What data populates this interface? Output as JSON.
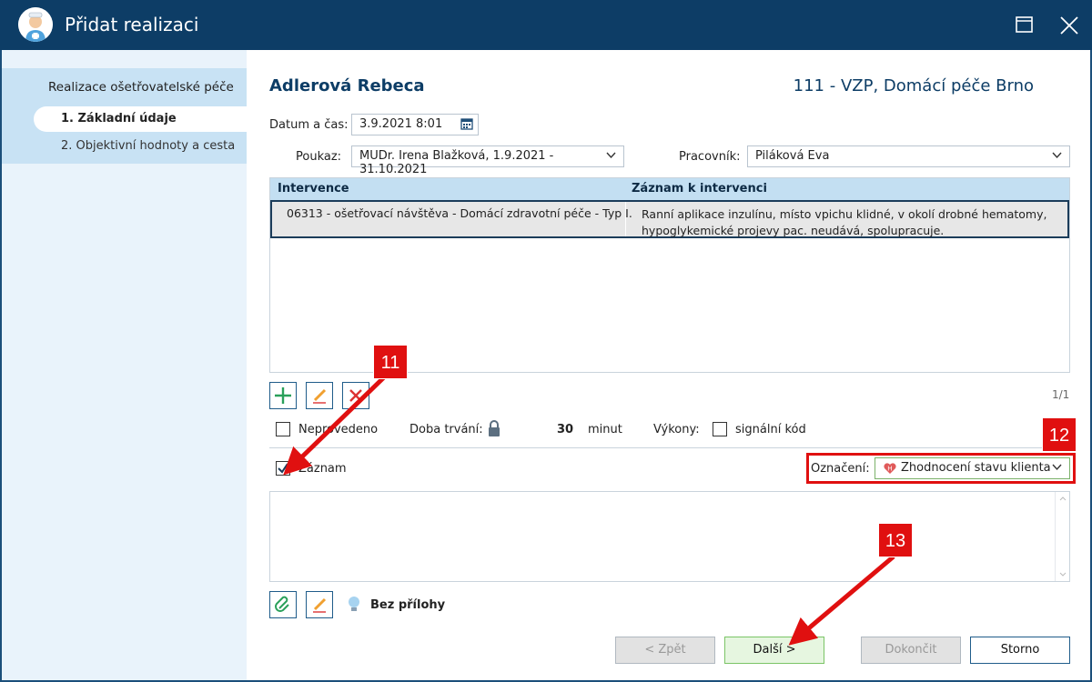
{
  "window": {
    "title": "Přidat realizaci"
  },
  "sidebar": {
    "heading": "Realizace ošetřovatelské péče",
    "items": [
      {
        "label": "1. Základní údaje",
        "active": true
      },
      {
        "label": "2. Objektivní hodnoty a cesta",
        "active": false
      }
    ]
  },
  "header": {
    "patient_name": "Adlerová Rebeca",
    "insurer": "111 - VZP, Domácí péče Brno"
  },
  "form": {
    "datetime_label": "Datum a čas:",
    "datetime_value": "3.9.2021 8:01",
    "voucher_label": "Poukaz:",
    "voucher_value": "MUDr. Irena Blažková, 1.9.2021 - 31.10.2021",
    "worker_label": "Pracovník:",
    "worker_value": "Piláková Eva"
  },
  "grid": {
    "columns": [
      "Intervence",
      "Záznam k intervenci"
    ],
    "rows": [
      {
        "intervention": "06313 - ošetřovací návštěva - Domácí zdravotní péče - Typ I.",
        "record_line1": "Ranní aplikace inzulínu, místo vpichu klidné, v okolí drobné hematomy,",
        "record_line2": "hypoglykemické projevy pac. neudává, spolupracuje."
      }
    ],
    "pager": "1/1"
  },
  "options": {
    "not_done_label": "Neprovedeno",
    "duration_label": "Doba trvání:",
    "duration_value": "30",
    "duration_unit": "minut",
    "services_label": "Výkony:",
    "signal_code_label": "signální kód",
    "record_label": "Záznam",
    "record_checked": true,
    "marking_label": "Označení:",
    "marking_value": "Zhodnocení stavu klienta"
  },
  "attachments": {
    "label": "Bez přílohy"
  },
  "buttons": {
    "back": "< Zpět",
    "next": "Další >",
    "finish": "Dokončit",
    "cancel": "Storno"
  },
  "callouts": [
    "11",
    "12",
    "13"
  ],
  "colors": {
    "title_bar": "#0d3d66",
    "accent": "#1f5c8a",
    "highlight_red": "#e01010",
    "next_button_bg": "#e6f6e0"
  }
}
